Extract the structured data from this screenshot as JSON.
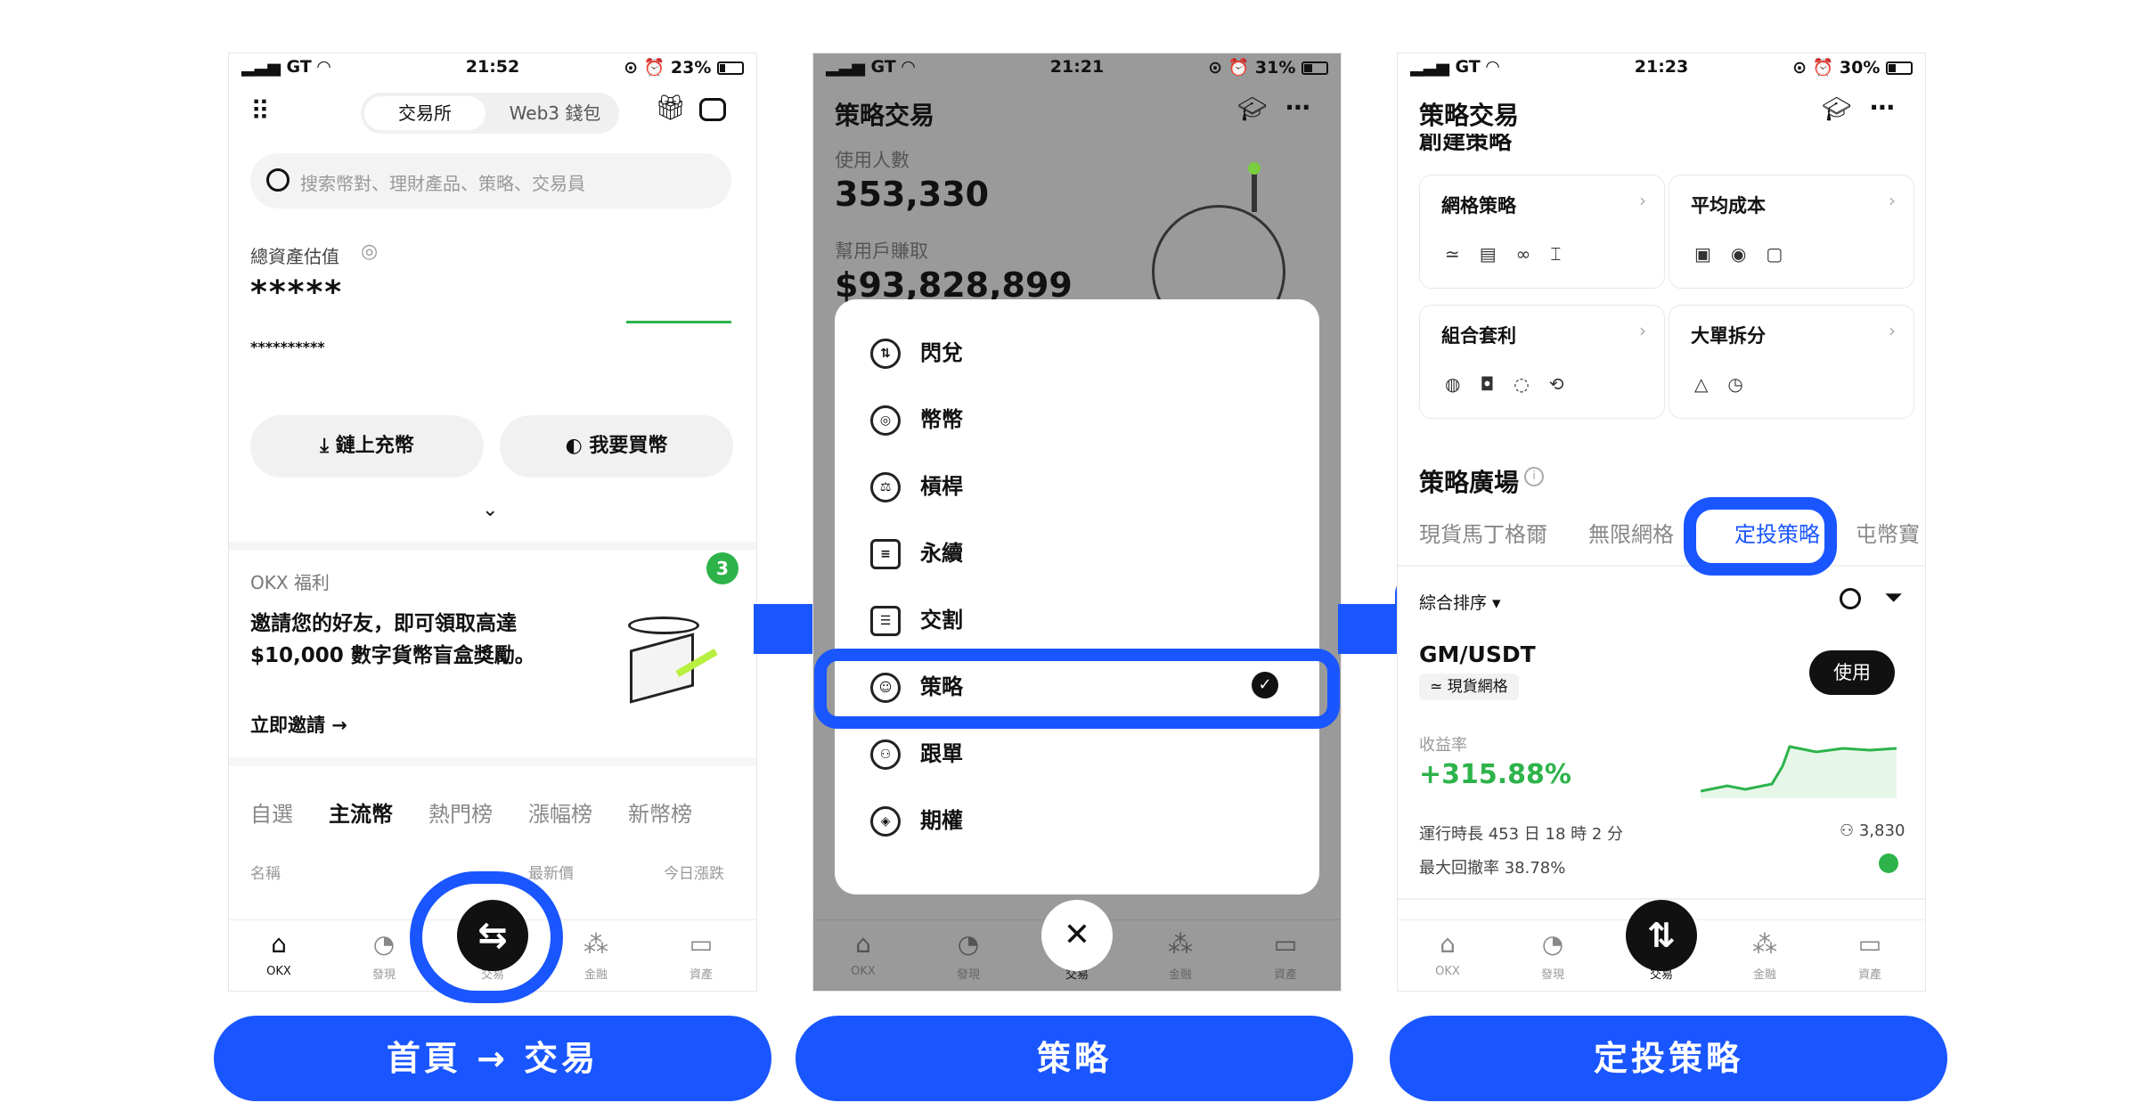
{
  "captions": [
    "首頁 → 交易",
    "策略",
    "定投策略"
  ],
  "p1": {
    "status": {
      "carrier": "GT",
      "time": "21:52",
      "battery": "23%"
    },
    "tabs": [
      "交易所",
      "Web3 錢包"
    ],
    "search_placeholder": "搜索幣對、理財產品、策略、交易員",
    "assets": {
      "label": "總資產估值",
      "value": "*****",
      "sub": "**********"
    },
    "actions": [
      "鏈上充幣",
      "我要買幣"
    ],
    "promo": {
      "tag": "OKX 福利",
      "text1": "邀請您的好友，即可領取高達",
      "text2": "$10,000 數字貨幣盲盒獎勵。",
      "link": "立即邀請",
      "badge": "3"
    },
    "market_tabs": [
      "自選",
      "主流幣",
      "熱門榜",
      "漲幅榜",
      "新幣榜"
    ],
    "cols": [
      "名稱",
      "最新價",
      "今日漲跌"
    ],
    "nav": [
      "OKX",
      "發現",
      "交易",
      "金融",
      "資產"
    ]
  },
  "p2": {
    "status": {
      "carrier": "GT",
      "time": "21:21",
      "battery": "31%"
    },
    "title": "策略交易",
    "users_label": "使用人數",
    "users": "353,330",
    "profit_label": "幫用戶賺取",
    "profit": "$93,828,899",
    "menu": [
      "閃兌",
      "幣幣",
      "槓桿",
      "永續",
      "交割",
      "策略",
      "跟單",
      "期權"
    ],
    "nav": [
      "OKX",
      "發現",
      "交易",
      "金融",
      "資產"
    ]
  },
  "p3": {
    "status": {
      "carrier": "GT",
      "time": "21:23",
      "battery": "30%"
    },
    "title": "策略交易",
    "section_cut": "創建策略",
    "cards": [
      "網格策略",
      "平均成本",
      "組合套利",
      "大單拆分"
    ],
    "plaza": "策略廣場",
    "tabs": [
      "現貨馬丁格爾",
      "無限網格",
      "定投策略",
      "屯幣寶"
    ],
    "sort": "綜合排序",
    "pair": "GM/USDT",
    "pair_tag": "現貨網格",
    "use_btn": "使用",
    "yield_label": "收益率",
    "yield": "+315.88%",
    "runtime": "運行時長 453 日 18 時 2 分",
    "users": "3,830",
    "drawdown": "最大回撤率 38.78%",
    "nav": [
      "OKX",
      "發現",
      "交易",
      "金融",
      "資產"
    ]
  },
  "colors": {
    "brand": "#1a56ff",
    "green": "#2db34a"
  }
}
